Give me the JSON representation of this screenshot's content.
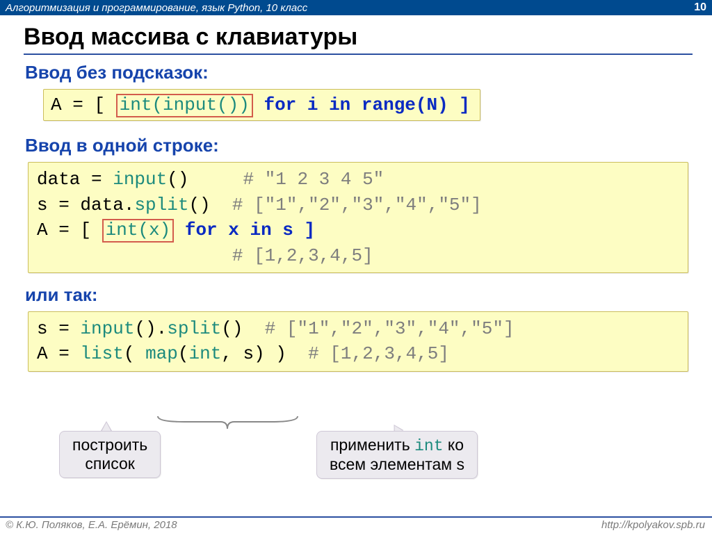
{
  "header": {
    "course": "Алгоритмизация и программирование, язык Python, 10 класс",
    "page": "10"
  },
  "title": "Ввод массива с клавиатуры",
  "sec1": {
    "title": "Ввод без подсказок:"
  },
  "code1": {
    "a": "A = [ ",
    "box": "int(input())",
    "rest": " for i in range(N) ]"
  },
  "sec2": {
    "title": "Ввод в одной строке:"
  },
  "code2": {
    "l1a": "data = ",
    "l1f": "input",
    "l1b": "()     ",
    "l1c": "# \"1 2 3 4 5\"",
    "l2a": "s = data.",
    "l2f": "split",
    "l2b": "()  ",
    "l2c": "# [\"1\",\"2\",\"3\",\"4\",\"5\"]",
    "l3a": "A = [ ",
    "l3box": "int(x)",
    "l3b": " for x in s ]",
    "l4pad": "                  ",
    "l4c": "# [1,2,3,4,5]"
  },
  "sec3": {
    "title": "или так:"
  },
  "code3": {
    "l1a": "s = ",
    "l1f1": "input",
    "l1b": "().",
    "l1f2": "split",
    "l1c": "()  ",
    "l1cm": "# [\"1\",\"2\",\"3\",\"4\",\"5\"]",
    "l2a": "A = ",
    "l2f1": "list",
    "l2b": "( ",
    "l2f2": "map",
    "l2c": "(",
    "l2f3": "int",
    "l2d": ", s) )  ",
    "l2cm": "# [1,2,3,4,5]"
  },
  "bubble1": {
    "line1": "построить",
    "line2": "список"
  },
  "bubble2": {
    "text1": "применить ",
    "mono": "int",
    "text2": " ко",
    "line2": "всем элементам s"
  },
  "footer": {
    "left": "© К.Ю. Поляков, Е.А. Ерёмин, 2018",
    "right": "http://kpolyakov.spb.ru"
  }
}
